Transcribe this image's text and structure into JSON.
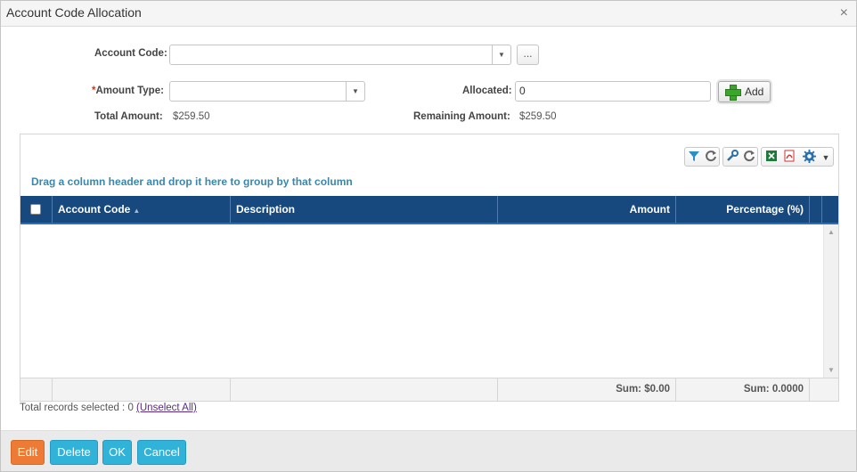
{
  "dialog": {
    "title": "Account Code Allocation",
    "close": "×"
  },
  "form": {
    "account_code_label": "Account Code:",
    "account_code_value": "",
    "ellipsis": "...",
    "required_mark": "*",
    "amount_type_label": "Amount Type:",
    "amount_type_value": "",
    "allocated_label": "Allocated:",
    "allocated_value": "0",
    "add_label": "Add",
    "total_amount_label": "Total Amount:",
    "total_amount_value": "$259.50",
    "remaining_amount_label": "Remaining Amount:",
    "remaining_amount_value": "$259.50"
  },
  "grid": {
    "toolbar_icons": [
      "filter-icon",
      "refresh-icon",
      "wrench-icon",
      "refresh-icon",
      "excel-icon",
      "pdf-icon",
      "gear-icon",
      "chevron-down-icon"
    ],
    "group_hint": "Drag a column header and drop it here to group by that column",
    "columns": [
      "Account Code",
      "Description",
      "Amount",
      "Percentage (%)"
    ],
    "rows": [],
    "footer": {
      "amount_sum": "Sum: $0.00",
      "percentage_sum": "Sum: 0.0000"
    }
  },
  "records": {
    "text": "Total records selected : 0",
    "unselect_link": "(Unselect All)"
  },
  "buttons": {
    "edit": "Edit",
    "delete": "Delete",
    "ok": "OK",
    "cancel": "Cancel"
  },
  "colors": {
    "header_bg": "#17497f",
    "accent_orange": "#ee7b35",
    "accent_blue": "#31b2d9",
    "hint_blue": "#3a87ad"
  }
}
